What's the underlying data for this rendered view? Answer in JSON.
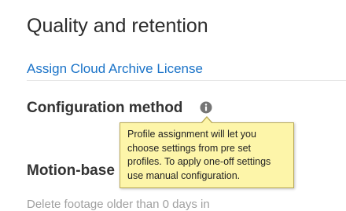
{
  "page": {
    "title": "Quality and retention",
    "license_link": "Assign Cloud Archive License"
  },
  "configuration": {
    "heading": "Configuration method",
    "info_icon": "info-icon",
    "tooltip": "Profile assignment will let you choose settings from pre set profiles. To apply one-off settings use manual configuration."
  },
  "motion": {
    "heading": "Motion-base",
    "faded_text": "Delete footage older than 0 days in"
  },
  "colors": {
    "link": "#1a73c8",
    "tooltip_bg": "#fdf5a9",
    "tooltip_border": "#b9a957",
    "icon": "#757575"
  }
}
